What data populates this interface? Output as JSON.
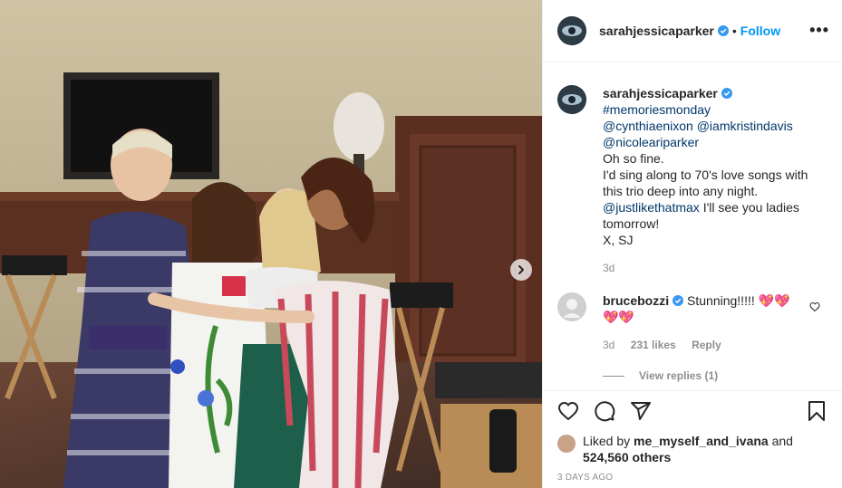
{
  "post": {
    "author": "sarahjessicaparker",
    "follow_label": "Follow",
    "dot": "•",
    "more": "•••"
  },
  "caption": {
    "author": "sarahjessicaparker",
    "hashtag": "#memoriesmonday",
    "mention1": "@cynthiaenixon",
    "mention2": "@iamkristindavis",
    "mention3": "@nicoleariparker",
    "line1": "Oh so fine.",
    "line2": "I'd sing along to 70's love songs with this trio deep into any night.",
    "mention4": "@justlikethatmax",
    "line3": " I'll see you ladies tomorrow!",
    "signoff": "X, SJ",
    "time": "3d"
  },
  "comment": {
    "author": "brucebozzi",
    "text": " Stunning!!!!!",
    "emoji_text": "💖💖💖💖",
    "time": "3d",
    "likes": "231 likes",
    "reply_label": "Reply",
    "view_replies": "View replies (1)"
  },
  "footer": {
    "liked_by_prefix": "Liked by ",
    "liked_by_user": "me_myself_and_ivana",
    "and": " and",
    "others": "524,560 others",
    "date": "3 DAYS AGO"
  },
  "colors": {
    "accent": "#0095f6",
    "link": "#00376b",
    "muted": "#8e8e8e",
    "verified": "#3897f0"
  },
  "icons": [
    "verified-badge-icon",
    "more-options-icon",
    "heart-icon",
    "comment-icon",
    "share-icon",
    "bookmark-icon",
    "chevron-right-icon"
  ]
}
